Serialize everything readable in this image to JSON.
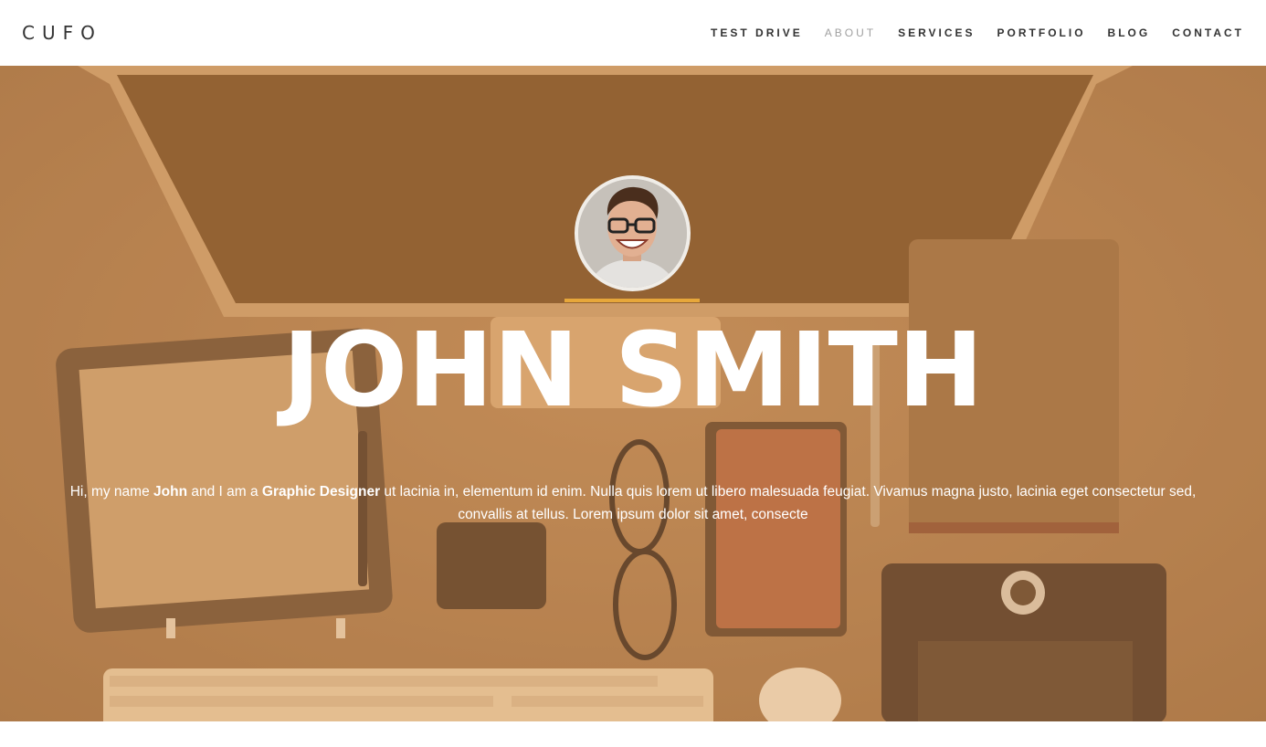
{
  "header": {
    "logo": "CUFO",
    "nav": [
      {
        "label": "TEST DRIVE",
        "active": false
      },
      {
        "label": "ABOUT",
        "active": true
      },
      {
        "label": "SERVICES",
        "active": false
      },
      {
        "label": "PORTFOLIO",
        "active": false
      },
      {
        "label": "BLOG",
        "active": false
      },
      {
        "label": "CONTACT",
        "active": false
      }
    ]
  },
  "hero": {
    "name": "JOHN SMITH",
    "bio": {
      "intro": "Hi, my name ",
      "first_name": "John",
      "middle": " and I am a ",
      "role": "Graphic Designer",
      "rest": " ut lacinia in, elementum id enim. Nulla quis lorem ut libero malesuada feugiat. Vivamus magna justo, lacinia eget consectetur sed, convallis at tellus. Lorem ipsum dolor sit amet, consecte"
    },
    "accent_color": "#e7a73a"
  }
}
